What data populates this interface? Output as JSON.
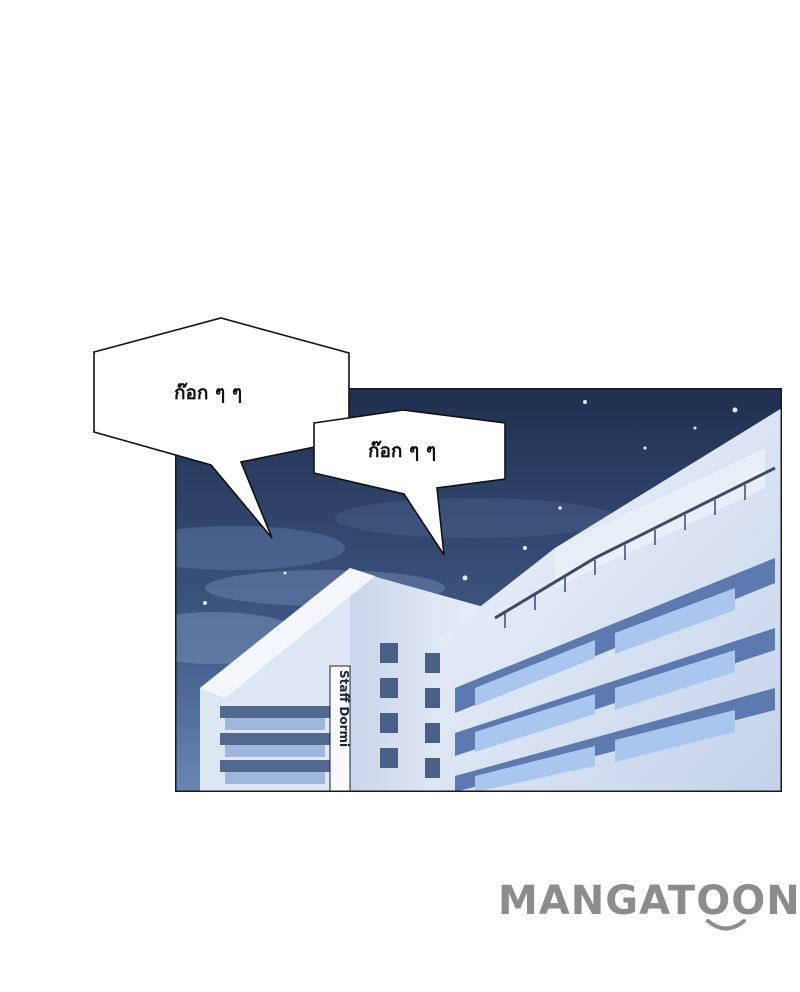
{
  "bubbles": {
    "first": "ก๊อก ๆ ๆ",
    "second": "ก๊อก ๆ ๆ"
  },
  "sign": {
    "text": "Staff Dormi"
  },
  "watermark": {
    "logo_text": "MANGATOON"
  },
  "colors": {
    "sky_top": "#1f2f4f",
    "sky_bottom": "#5d7aa8",
    "building_light": "#e8eef7",
    "building_shadow": "#7f93b8",
    "window": "#a9c4ea",
    "watermark": "#8c8c8c"
  }
}
